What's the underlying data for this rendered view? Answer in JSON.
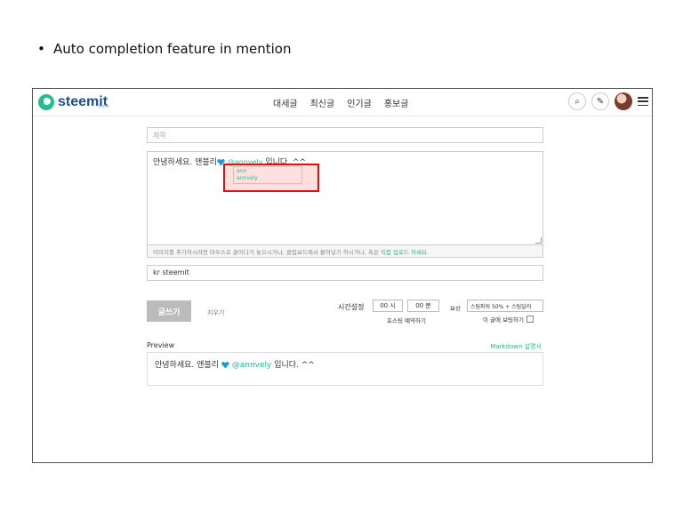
{
  "slide": {
    "bullet": "•",
    "title": "Auto completion feature in mention"
  },
  "header": {
    "logo_text": "steemit",
    "logo_beta": "beta",
    "nav": [
      "대세글",
      "최신글",
      "인기글",
      "홍보글"
    ],
    "search_icon": "⌕",
    "pencil_icon": "✎"
  },
  "editor": {
    "title_placeholder": "제목",
    "body_text_before": "안녕하세요. 앤블리",
    "body_mention": "@annvely",
    "body_text_after": " 입니다. ^^",
    "autocomplete": [
      "ann",
      "annvely"
    ],
    "upload_hint_text": "이미지를 추가하시려면 마우스로 끌어다가 놓으시거나, 클립보드에서 붙여넣기 하시거나, 혹은 ",
    "upload_hint_link": "직접 업로드 하세요.",
    "tags_value": "kr steemit"
  },
  "actions": {
    "post_button": "글쓰기",
    "clear_link": "지우기",
    "schedule_label": "시간설정",
    "hour_value": "00 시",
    "minute_value": "00 분",
    "schedule_note": "포스팅 예약하기",
    "reward_label": "보상",
    "reward_value": "스팀파워 50% + 스팀달러",
    "boost_label": "이 글에 보팅하기"
  },
  "preview": {
    "label": "Preview",
    "markdown_link": "Markdown 설명서",
    "text_before": "안녕하세요. 앤블리",
    "mention": "@annvely",
    "text_after": " 입니다. ^^"
  },
  "colors": {
    "accent": "#1fbf8f",
    "logo_blue": "#1a5099",
    "highlight": "#e01010",
    "heart": "#1e9ad6"
  }
}
